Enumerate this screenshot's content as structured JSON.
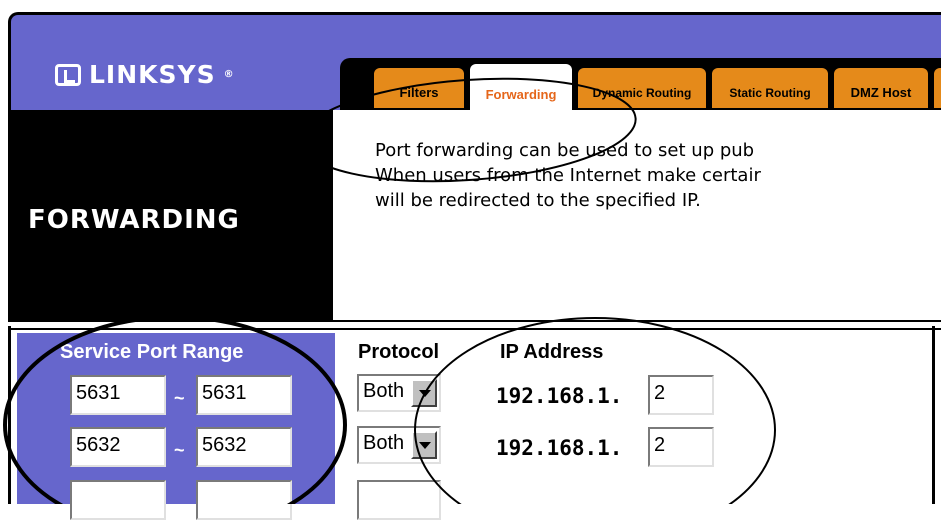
{
  "brand": {
    "name": "LINKSYS",
    "trademark": "®"
  },
  "tabs": [
    {
      "label": "Filters"
    },
    {
      "label": "Forwarding"
    },
    {
      "label": "Dynamic Routing"
    },
    {
      "label": "Static Routing"
    },
    {
      "label": "DMZ Host"
    }
  ],
  "sidebar": {
    "title": "FORWARDING"
  },
  "description": {
    "line1": "Port forwarding can be used to set up pub",
    "line2": "When users from the Internet make certair",
    "line3": "will be redirected to the specified IP."
  },
  "table": {
    "headers": {
      "port_range": "Service Port Range",
      "protocol": "Protocol",
      "ip": "IP Address"
    },
    "separator": "~",
    "ip_prefix": "192.168.1.",
    "rows": [
      {
        "port_start": "5631",
        "port_end": "5631",
        "protocol": "Both",
        "ip_last": "2"
      },
      {
        "port_start": "5632",
        "port_end": "5632",
        "protocol": "Both",
        "ip_last": "2"
      }
    ]
  }
}
